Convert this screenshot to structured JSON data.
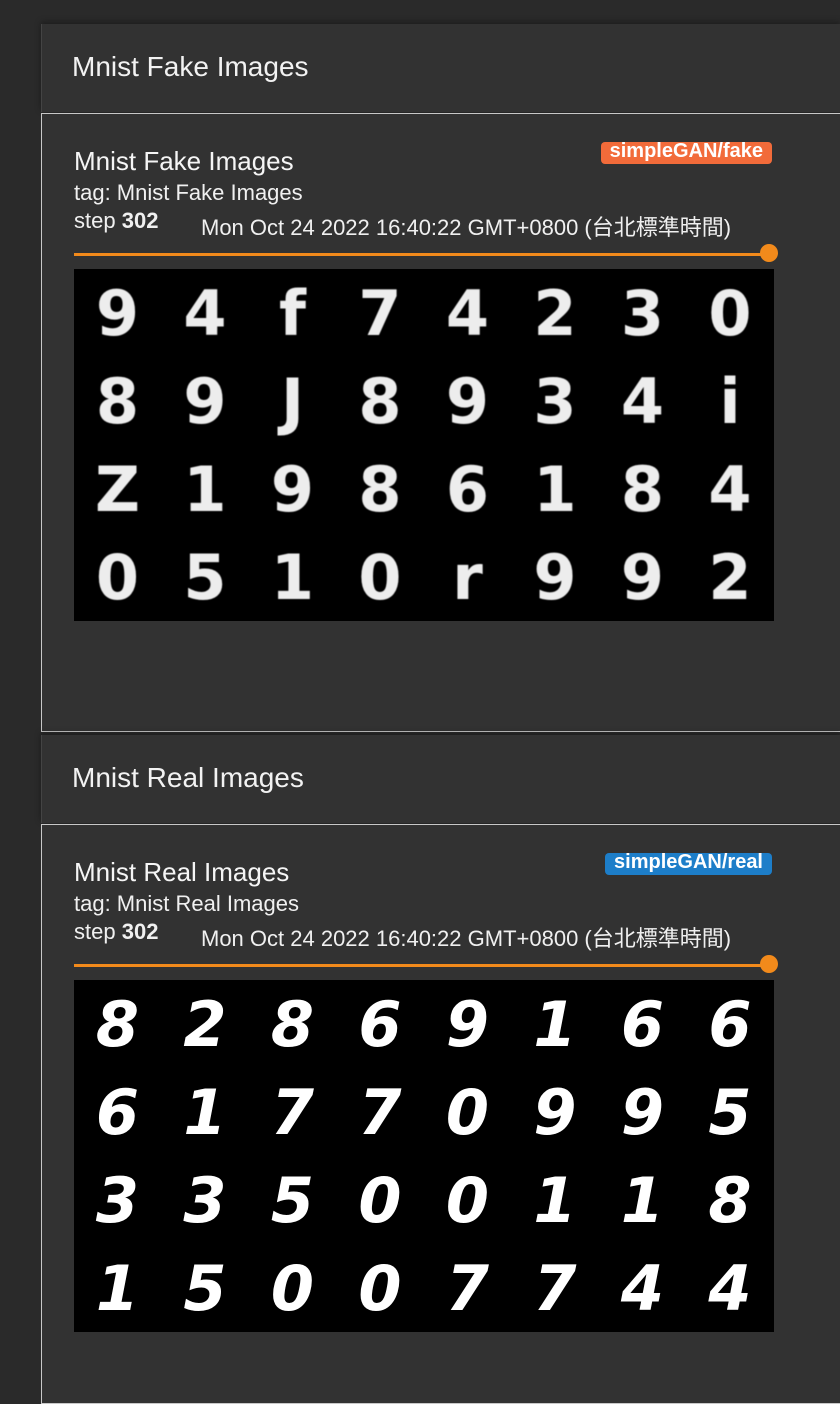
{
  "sections": [
    {
      "header": "Mnist Fake Images",
      "card": {
        "name": "Mnist Fake Images",
        "tag": "tag: Mnist Fake Images",
        "step_label": "step",
        "step": "302",
        "timestamp": "Mon Oct 24 2022 16:40:22 GMT+0800 (台北標準時間)",
        "run_badge": "simpleGAN/fake",
        "badge_color": "#f26b3a",
        "slider_value": 1.0,
        "digits": [
          "9",
          "4",
          "f",
          "7",
          "4",
          "2",
          "3",
          "0",
          "8",
          "9",
          "J",
          "8",
          "9",
          "3",
          "4",
          "i",
          "Z",
          "1",
          "9",
          "8",
          "6",
          "1",
          "8",
          "4",
          "0",
          "5",
          "1",
          "0",
          "r",
          "9",
          "9",
          "2"
        ]
      }
    },
    {
      "header": "Mnist Real Images",
      "card": {
        "name": "Mnist Real Images",
        "tag": "tag: Mnist Real Images",
        "step_label": "step",
        "step": "302",
        "timestamp": "Mon Oct 24 2022 16:40:22 GMT+0800 (台北標準時間)",
        "run_badge": "simpleGAN/real",
        "badge_color": "#1d7ec9",
        "slider_value": 1.0,
        "digits": [
          "8",
          "2",
          "8",
          "6",
          "9",
          "1",
          "6",
          "6",
          "6",
          "1",
          "7",
          "7",
          "0",
          "9",
          "9",
          "5",
          "3",
          "3",
          "5",
          "0",
          "0",
          "1",
          "1",
          "8",
          "1",
          "5",
          "0",
          "0",
          "7",
          "7",
          "4",
          "4"
        ]
      }
    }
  ]
}
